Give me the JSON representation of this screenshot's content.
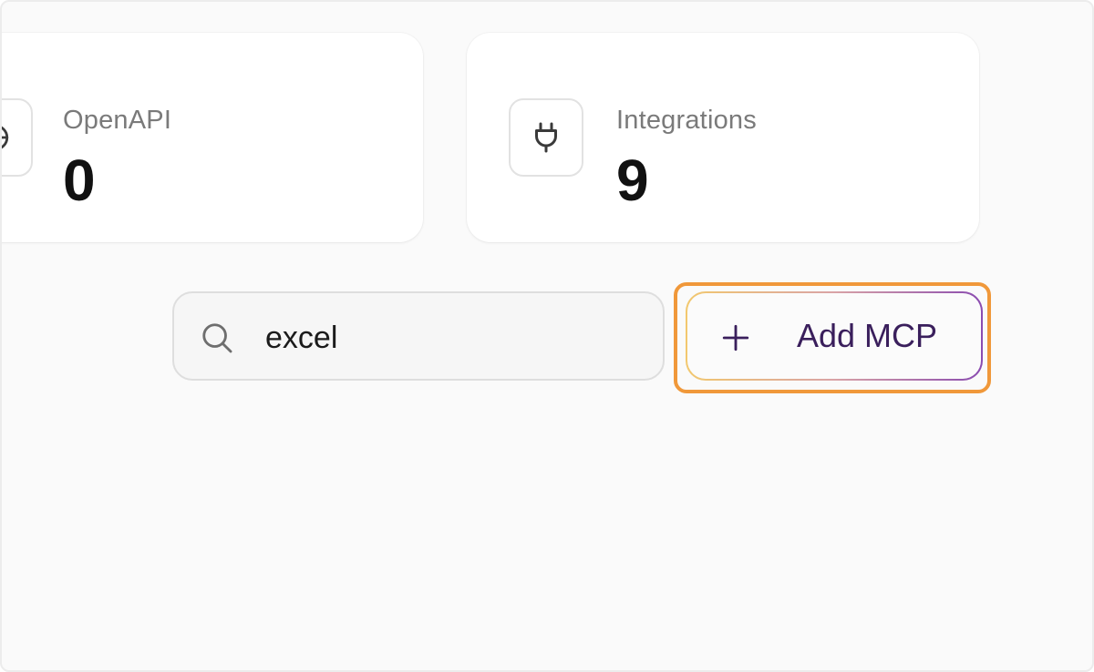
{
  "stats": [
    {
      "label": "OpenAPI",
      "value": "0",
      "icon": "globe-icon"
    },
    {
      "label": "Integrations",
      "value": "9",
      "icon": "plug-icon"
    }
  ],
  "search": {
    "value": "excel",
    "placeholder": "",
    "icon": "search-icon"
  },
  "actions": {
    "add_mcp_label": "Add MCP",
    "add_icon": "plus-icon"
  },
  "colors": {
    "highlight": "#f0983a",
    "button_text": "#3a1f5c",
    "button_border_start": "#f2c86e",
    "button_border_end": "#8a4bb0"
  }
}
